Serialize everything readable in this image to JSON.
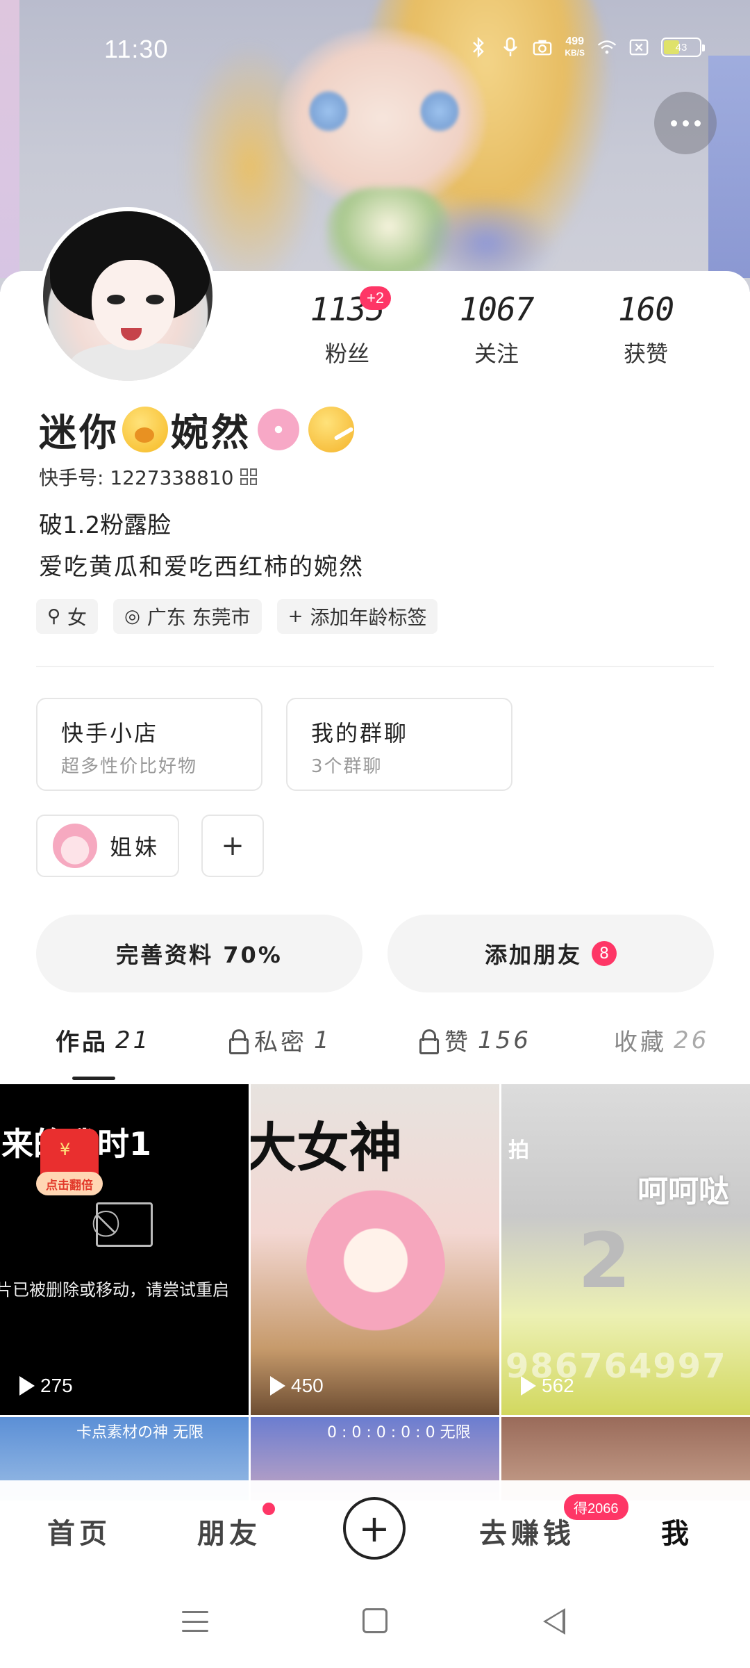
{
  "status_bar": {
    "time": "11:30",
    "net_speed_value": "499",
    "net_speed_unit": "KB/S",
    "battery": "43",
    "icons": [
      "bluetooth-icon",
      "mic-icon",
      "camera-icon",
      "wifi-icon",
      "sim-off-icon",
      "battery-icon"
    ]
  },
  "profile": {
    "more_icon": "more-dots-icon",
    "stats": [
      {
        "value": "1135",
        "label": "粉丝",
        "badge": "+2"
      },
      {
        "value": "1067",
        "label": "关注"
      },
      {
        "value": "160",
        "label": "获赞"
      }
    ],
    "nickname_parts": [
      "迷你",
      "婉然"
    ],
    "nickname_emojis": [
      "yawning-face-emoji",
      "cherry-blossom-emoji",
      "thermometer-face-emoji"
    ],
    "kuaishou_id": "快手号: 1227338810",
    "bio_line1": "破1.2粉露脸",
    "bio_line2": "爱吃黄瓜和爱吃西红柿的婉然",
    "tags": [
      {
        "icon": "female-icon",
        "glyph": "⚲",
        "label": "女"
      },
      {
        "icon": "location-pin-icon",
        "glyph": "◎",
        "label": "广东 东莞市"
      },
      {
        "icon": "plus-icon",
        "glyph": "+",
        "label": "添加年龄标签"
      }
    ]
  },
  "cards": {
    "shop": {
      "title": "快手小店",
      "subtitle": "超多性价比好物"
    },
    "group": {
      "title": "我的群聊",
      "subtitle": "3个群聊"
    },
    "sister": {
      "label": "姐妹"
    },
    "add": "+"
  },
  "actions": {
    "complete_profile": "完善资料 70%",
    "add_friend": "添加朋友",
    "add_friend_count": "8"
  },
  "tabs": [
    {
      "label": "作品",
      "count": "21",
      "active": true
    },
    {
      "label": "私密",
      "count": "1",
      "locked": true
    },
    {
      "label": "赞",
      "count": "156",
      "locked": true
    },
    {
      "label": "收藏",
      "count": "26"
    }
  ],
  "videos": [
    {
      "caption": "来的我时1",
      "error": "片已被删除或移动，请尝试重启",
      "redpack_label": "点击翻倍",
      "plays": "275"
    },
    {
      "caption": "大女神",
      "plays": "450"
    },
    {
      "caption_top": "拍",
      "caption": "呵呵哒",
      "number": "2",
      "phone": "986764997",
      "plays": "562"
    },
    {
      "caption": "卡点素材の神 无限"
    },
    {
      "caption": "0 : 0 : 0 : 0 : 0  无限"
    },
    {
      "caption": ""
    }
  ],
  "bottom_nav": {
    "home": "首页",
    "friends": "朋友",
    "earn": "去赚钱",
    "earn_badge": "得2066",
    "me": "我"
  }
}
